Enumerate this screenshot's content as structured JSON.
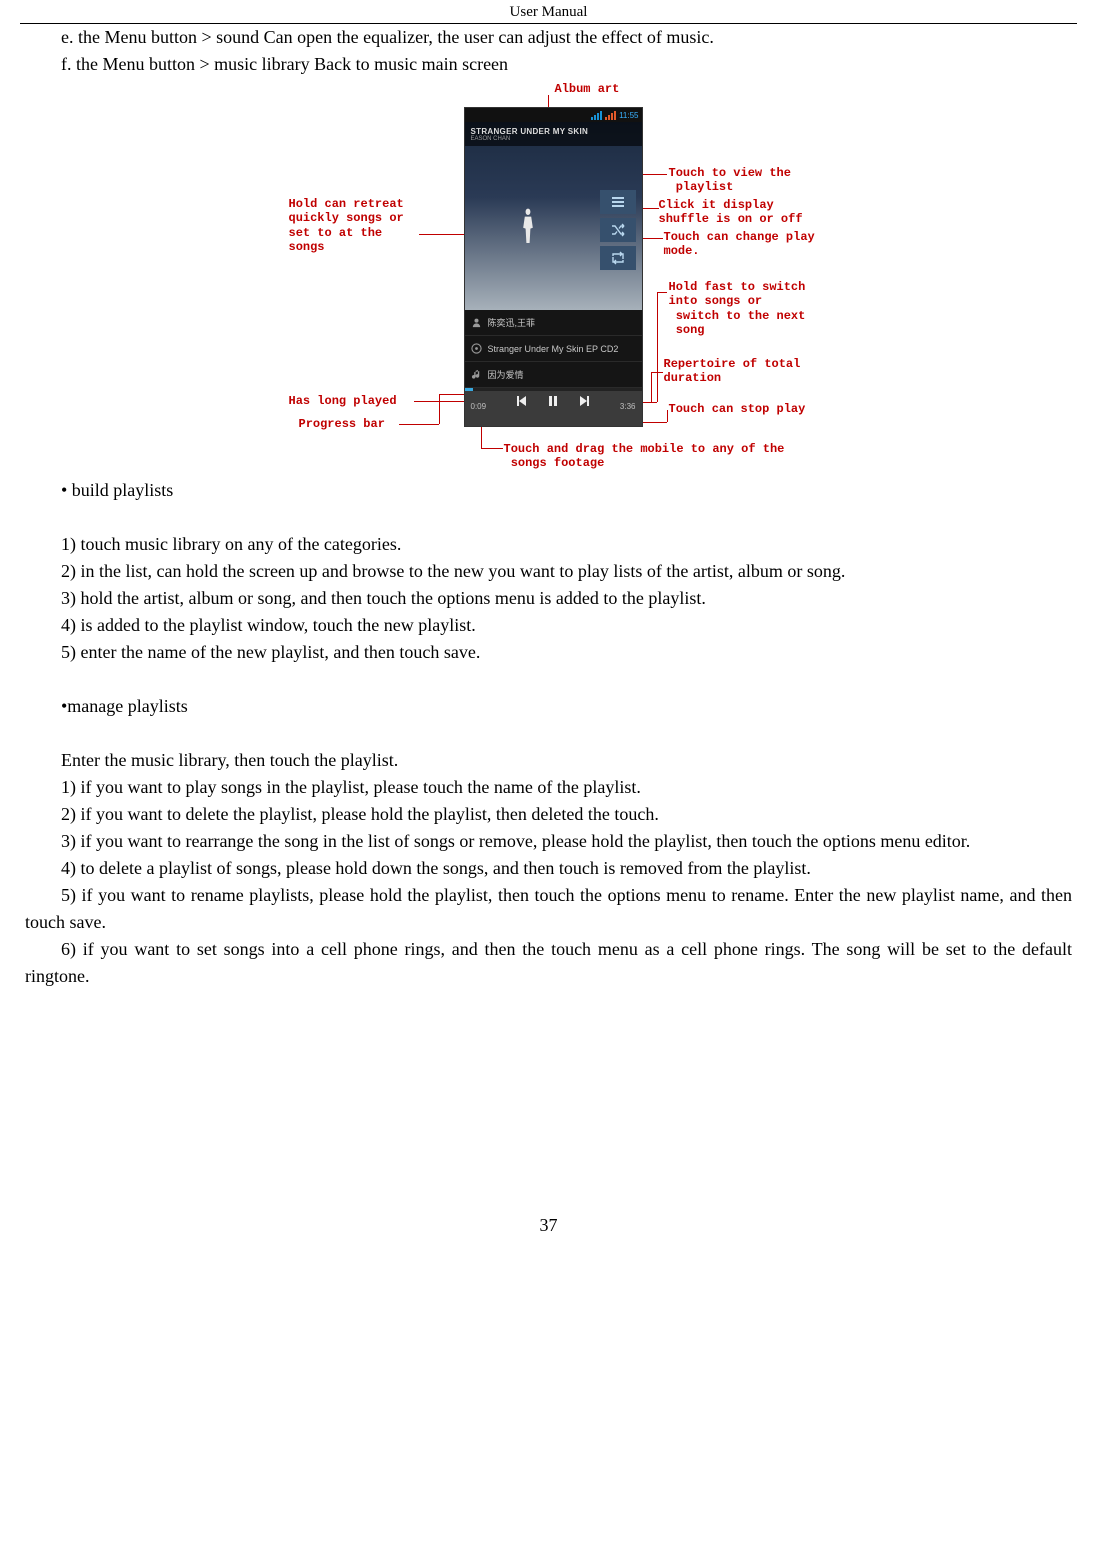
{
  "header": {
    "title": "User  Manual"
  },
  "text": {
    "line_e": "e. the Menu button > sound Can open the equalizer, the user can adjust the effect of music.",
    "line_f": "f. the Menu button > music library Back to music main screen",
    "bullet_build": "• build playlists",
    "build_1": "1) touch music library on any of the categories.",
    "build_2": "2) in the list, can hold the screen up and browse to the new you want to play lists of the artist, album or song.",
    "build_3": "3) hold the artist, album or song, and then touch the options menu is added to the playlist.",
    "build_4": "4) is added to the playlist window, touch the new playlist.",
    "build_5": "5) enter the name of the new playlist, and then touch save.",
    "bullet_manage": " •manage playlists",
    "manage_intro": "Enter the music library, then touch the playlist.",
    "manage_1": "1) if you want to play songs in the playlist, please touch the name of the playlist.",
    "manage_2": "2) if you want to delete the playlist, please hold the playlist, then deleted the touch.",
    "manage_3": "3) if you want to rearrange the song in the list of songs or remove, please hold the playlist, then touch the options menu editor.",
    "manage_4": "4) to delete a playlist of songs, please hold down the songs, and then touch is removed from the playlist.",
    "manage_5": "5) if you want to rename playlists, please hold the playlist, then touch the options menu to rename. Enter the new playlist name, and then touch save.",
    "manage_6": "6) if you want to set songs into a cell phone rings, and then the touch menu as a cell phone rings. The song will be set to the default ringtone."
  },
  "figure": {
    "status_time": "11:55",
    "album_title": "STRANGER UNDER MY SKIN",
    "album_sub": "EASON CHAN",
    "info_artist": "陈奕迅,王菲",
    "info_album": "Stranger Under My Skin EP CD2",
    "info_song": "因为爱情",
    "time_elapsed": "0:09",
    "time_total": "3:36",
    "annot": {
      "album_art": "Album art",
      "hold_retreat": "Hold can retreat\nquickly songs or\nset to at the\nsongs",
      "has_long_played": "Has long played",
      "progress_bar": "Progress bar",
      "view_playlist": "Touch to view the\n playlist",
      "shuffle": "Click it display\nshuffle is on or off",
      "play_mode": "Touch can change play\nmode.",
      "hold_fast": "Hold fast to switch\ninto songs or\n switch to the next\n song",
      "total_duration": "Repertoire of total\nduration",
      "stop_play": "Touch can stop play",
      "drag_footage": "Touch and drag the mobile to any of the\n songs footage"
    }
  },
  "page_number": "37"
}
